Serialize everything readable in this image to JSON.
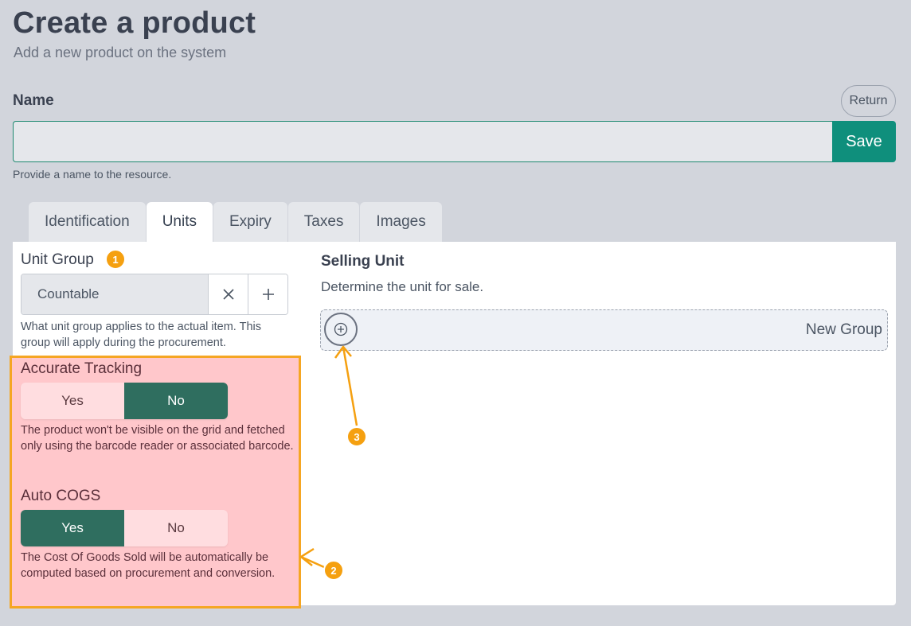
{
  "page": {
    "title": "Create a product",
    "subtitle": "Add a new product on the system"
  },
  "name_field": {
    "label": "Name",
    "value": "",
    "help": "Provide a name to the resource."
  },
  "actions": {
    "return_label": "Return",
    "save_label": "Save"
  },
  "tabs": [
    {
      "label": "Identification",
      "active": false
    },
    {
      "label": "Units",
      "active": true
    },
    {
      "label": "Expiry",
      "active": false
    },
    {
      "label": "Taxes",
      "active": false
    },
    {
      "label": "Images",
      "active": false
    }
  ],
  "unit_group": {
    "title": "Unit Group",
    "value": "Countable",
    "help": "What unit group applies to the actual item. This group will apply during the procurement."
  },
  "accurate_tracking": {
    "title": "Accurate Tracking",
    "yes_label": "Yes",
    "no_label": "No",
    "selected": "No",
    "help": "The product won't be visible on the grid and fetched only using the barcode reader or associated barcode."
  },
  "auto_cogs": {
    "title": "Auto COGS",
    "yes_label": "Yes",
    "no_label": "No",
    "selected": "Yes",
    "help": "The Cost Of Goods Sold will be automatically be computed based on procurement and conversion."
  },
  "selling_unit": {
    "title": "Selling Unit",
    "subtitle": "Determine the unit for sale.",
    "new_group_label": "New Group"
  },
  "annotations": {
    "badge_1": "1",
    "badge_2": "2",
    "badge_3": "3",
    "color": "#f5a010",
    "highlight_fill": "#ffc7cb"
  },
  "colors": {
    "accent": "#0f8f7c",
    "toggle_on": "#2f6e5f",
    "background": "#d2d5dc"
  }
}
